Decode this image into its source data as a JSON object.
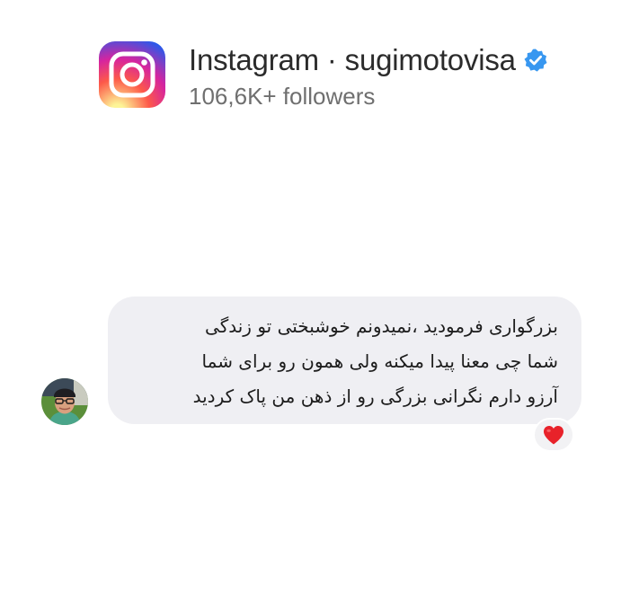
{
  "header": {
    "app_icon": "instagram-icon",
    "title": "Instagram · sugimotovisa",
    "verified_icon": "verified-badge-icon",
    "followers": "106,6K+ followers"
  },
  "message": {
    "avatar_icon": "user-avatar",
    "lines": [
      "بزرگواری فرمودید ،نمیدونم خوشبختی تو زندگی",
      "شما چی معنا پیدا میکنه ولی همون رو برای شما",
      "آرزو دارم نگرانی بزرگی رو از ذهن من پاک کردید"
    ],
    "reaction": "❤️",
    "reaction_icon": "heart-icon"
  },
  "colors": {
    "bubble_bg": "#efeff3",
    "verified_blue": "#3897f0",
    "heart_red": "#e8222a"
  }
}
